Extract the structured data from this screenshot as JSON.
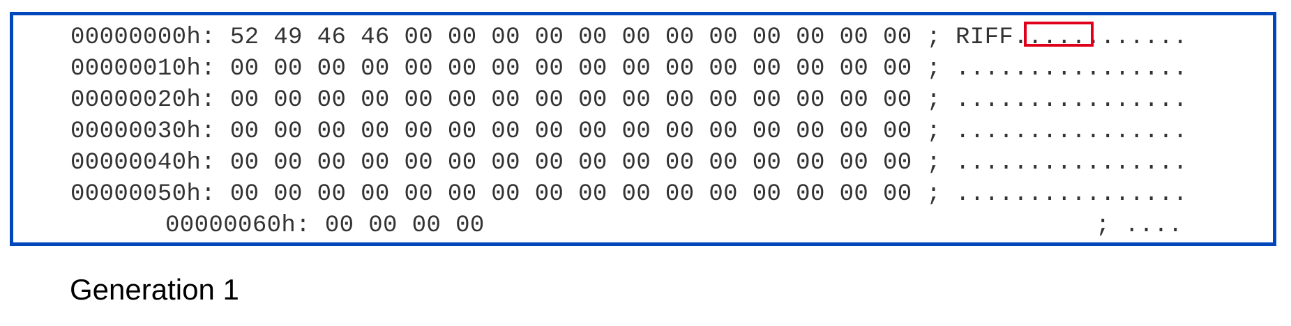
{
  "hex_dump": {
    "rows": [
      "00000000h: 52 49 46 46 00 00 00 00 00 00 00 00 00 00 00 00 ; RIFF............",
      "00000010h: 00 00 00 00 00 00 00 00 00 00 00 00 00 00 00 00 ; ................",
      "00000020h: 00 00 00 00 00 00 00 00 00 00 00 00 00 00 00 00 ; ................",
      "00000030h: 00 00 00 00 00 00 00 00 00 00 00 00 00 00 00 00 ; ................",
      "00000040h: 00 00 00 00 00 00 00 00 00 00 00 00 00 00 00 00 ; ................",
      "00000050h: 00 00 00 00 00 00 00 00 00 00 00 00 00 00 00 00 ; ................"
    ],
    "last_row_bytes": "00000060h: 00 00 00 00",
    "last_row_ascii": "; ...."
  },
  "caption": "Generation 1",
  "colors": {
    "panel_border": "#0047bb",
    "highlight_border": "#e0001b",
    "text": "#333333"
  }
}
